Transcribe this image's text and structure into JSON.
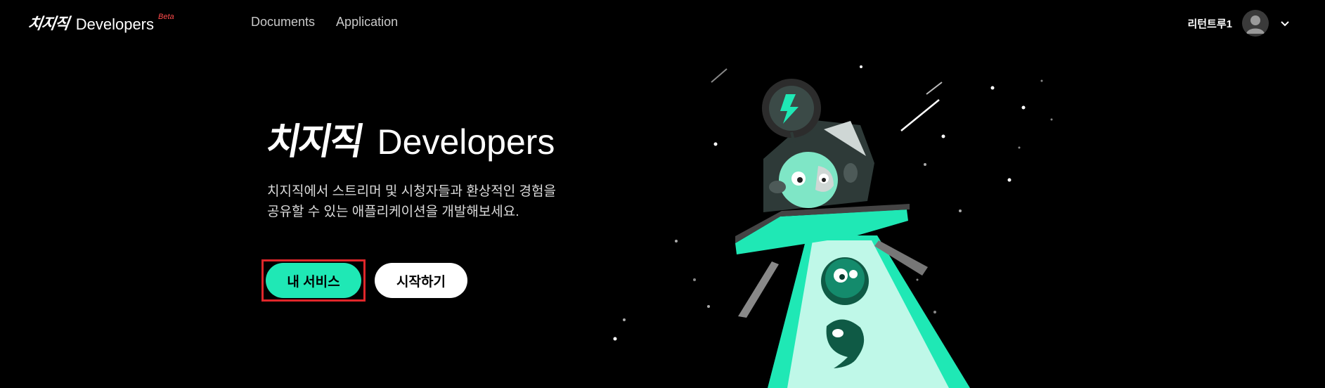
{
  "header": {
    "brand_logo": "치지직",
    "brand_name": "Developers",
    "brand_badge": "Beta",
    "nav": [
      {
        "label": "Documents"
      },
      {
        "label": "Application"
      }
    ],
    "user": {
      "name": "리턴트루1",
      "avatar_icon": "user-avatar-icon",
      "menu_icon": "chevron-down-icon"
    }
  },
  "hero": {
    "logo": "치지직",
    "title": "Developers",
    "description_line1": "치지직에서 스트리머 및 시청자들과 환상적인 경험을",
    "description_line2": "공유할 수 있는 애플리케이션을 개발해보세요.",
    "primary_button": "내 서비스",
    "secondary_button": "시작하기"
  },
  "colors": {
    "background": "#000000",
    "accent": "#1fe8b5",
    "highlight_border": "#e0262a",
    "beta": "#ff4b4b"
  },
  "illustration": {
    "icon": "ufo-mascot-illustration"
  }
}
